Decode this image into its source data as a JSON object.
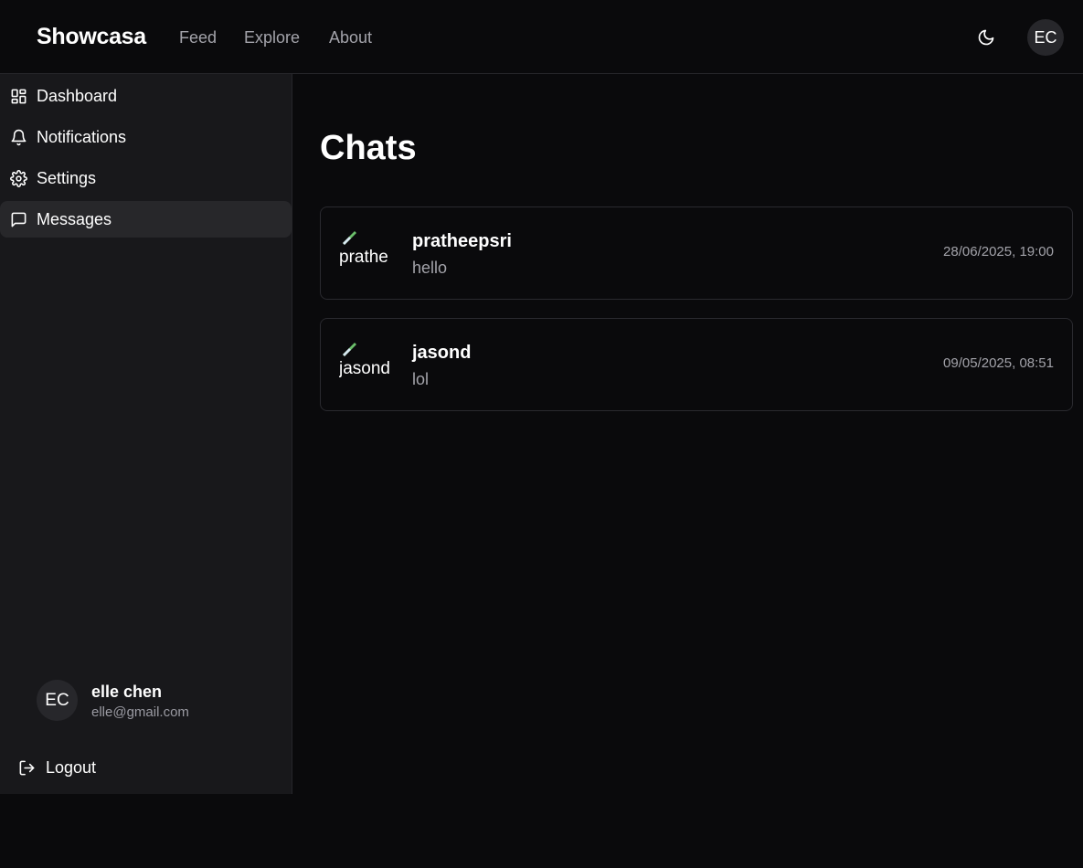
{
  "header": {
    "brand": "Showcasa",
    "nav": [
      "Feed",
      "Explore",
      "About"
    ],
    "avatar_initials": "EC",
    "theme_icon": "moon-icon"
  },
  "sidebar": {
    "items": [
      {
        "label": "Dashboard",
        "icon": "dashboard-icon"
      },
      {
        "label": "Notifications",
        "icon": "bell-icon"
      },
      {
        "label": "Settings",
        "icon": "gear-icon"
      },
      {
        "label": "Messages",
        "icon": "message-icon",
        "active": true
      }
    ],
    "user": {
      "initials": "EC",
      "name": "elle chen",
      "email": "elle@gmail.com"
    },
    "logout_label": "Logout"
  },
  "main": {
    "title": "Chats",
    "chats": [
      {
        "username": "pratheepsri",
        "avatar_alt": "prathe",
        "preview": "hello",
        "timestamp": "28/06/2025, 19:00"
      },
      {
        "username": "jasond",
        "avatar_alt": "jasond",
        "preview": "lol",
        "timestamp": "09/05/2025, 08:51"
      }
    ]
  },
  "colors": {
    "background": "#0a0a0c",
    "sidebar": "#18181b",
    "active_item": "#27272a",
    "muted_text": "#a3a3aa"
  }
}
